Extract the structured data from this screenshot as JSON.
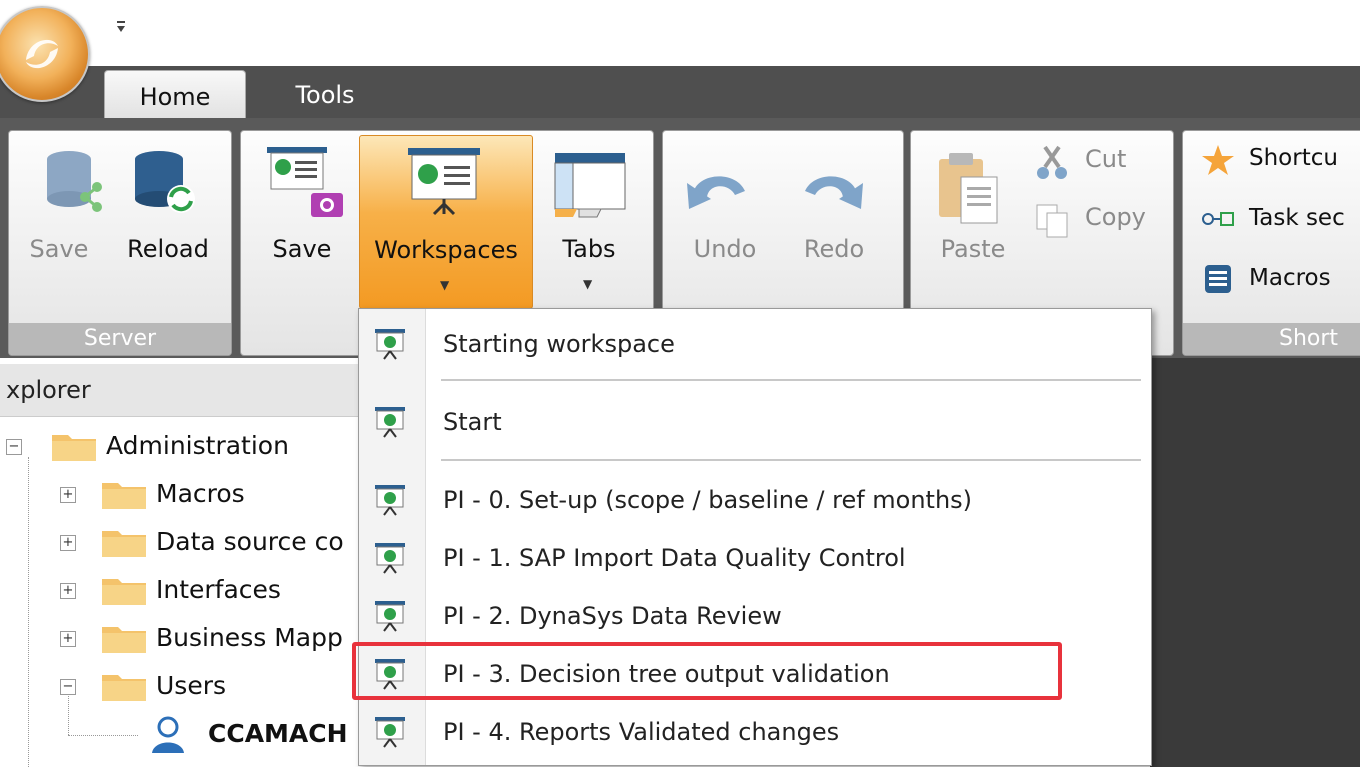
{
  "tabs": {
    "home": "Home",
    "tools": "Tools"
  },
  "qat_icon": "customize-quick-access-icon",
  "groups": {
    "server": {
      "label": "Server",
      "save": "Save",
      "reload": "Reload"
    },
    "workspace": {
      "save": "Save",
      "workspaces": "Workspaces",
      "tabs": "Tabs"
    },
    "edit": {
      "undo": "Undo",
      "redo": "Redo"
    },
    "clipboard": {
      "paste": "Paste",
      "cut": "Cut",
      "copy": "Copy"
    },
    "shortcuts": {
      "label": "Short",
      "shortcut": "Shortcu",
      "task": "Task sec",
      "macros": "Macros"
    }
  },
  "explorer": {
    "title": "xplorer",
    "tree": [
      {
        "label": "Administration"
      },
      {
        "label": "Macros"
      },
      {
        "label": "Data source co"
      },
      {
        "label": "Interfaces"
      },
      {
        "label": "Business Mapp"
      },
      {
        "label": "Users"
      },
      {
        "label": "CCAMACH"
      }
    ]
  },
  "workspaces_menu": {
    "items": [
      "Starting workspace",
      "Start",
      "PI - 0. Set-up (scope / baseline / ref months)",
      "PI - 1. SAP Import Data Quality Control",
      "PI - 2. DynaSys Data Review",
      "PI - 3. Decision tree output validation",
      "PI - 4. Reports  Validated changes"
    ],
    "highlighted_index": 5
  },
  "colors": {
    "accent": "#f5a43a",
    "highlight_box": "#e8323c",
    "ribbon_bg": "#5a5a5a"
  }
}
